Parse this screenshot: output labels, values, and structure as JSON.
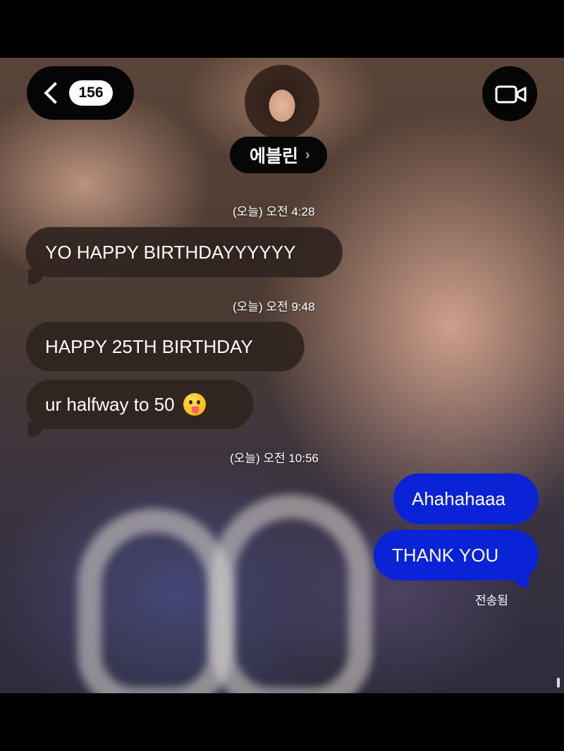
{
  "header": {
    "back_icon": "chevron-left-icon",
    "unread_count": "156",
    "contact_name": "에블린",
    "name_chevron": "›",
    "video_icon": "video-camera-icon"
  },
  "messages": [
    {
      "timestamp": "(오늘) 오전 4:28"
    },
    {
      "text": "YO HAPPY BIRTHDAYYYYYY",
      "direction": "incoming"
    },
    {
      "timestamp": "(오늘) 오전 9:48"
    },
    {
      "text": "HAPPY 25TH BIRTHDAY",
      "direction": "incoming"
    },
    {
      "text": "ur halfway to 50",
      "direction": "incoming",
      "emoji": "face-with-tongue-emoji"
    },
    {
      "timestamp": "(오늘) 오전 10:56"
    },
    {
      "text": "Ahahahaaa",
      "direction": "outgoing"
    },
    {
      "text": "THANK YOU",
      "direction": "outgoing"
    }
  ],
  "status": {
    "delivered": "전송됨"
  },
  "colors": {
    "outgoing_bubble": "#0a23d6",
    "incoming_bubble": "#302420",
    "header_button": "#050505"
  }
}
